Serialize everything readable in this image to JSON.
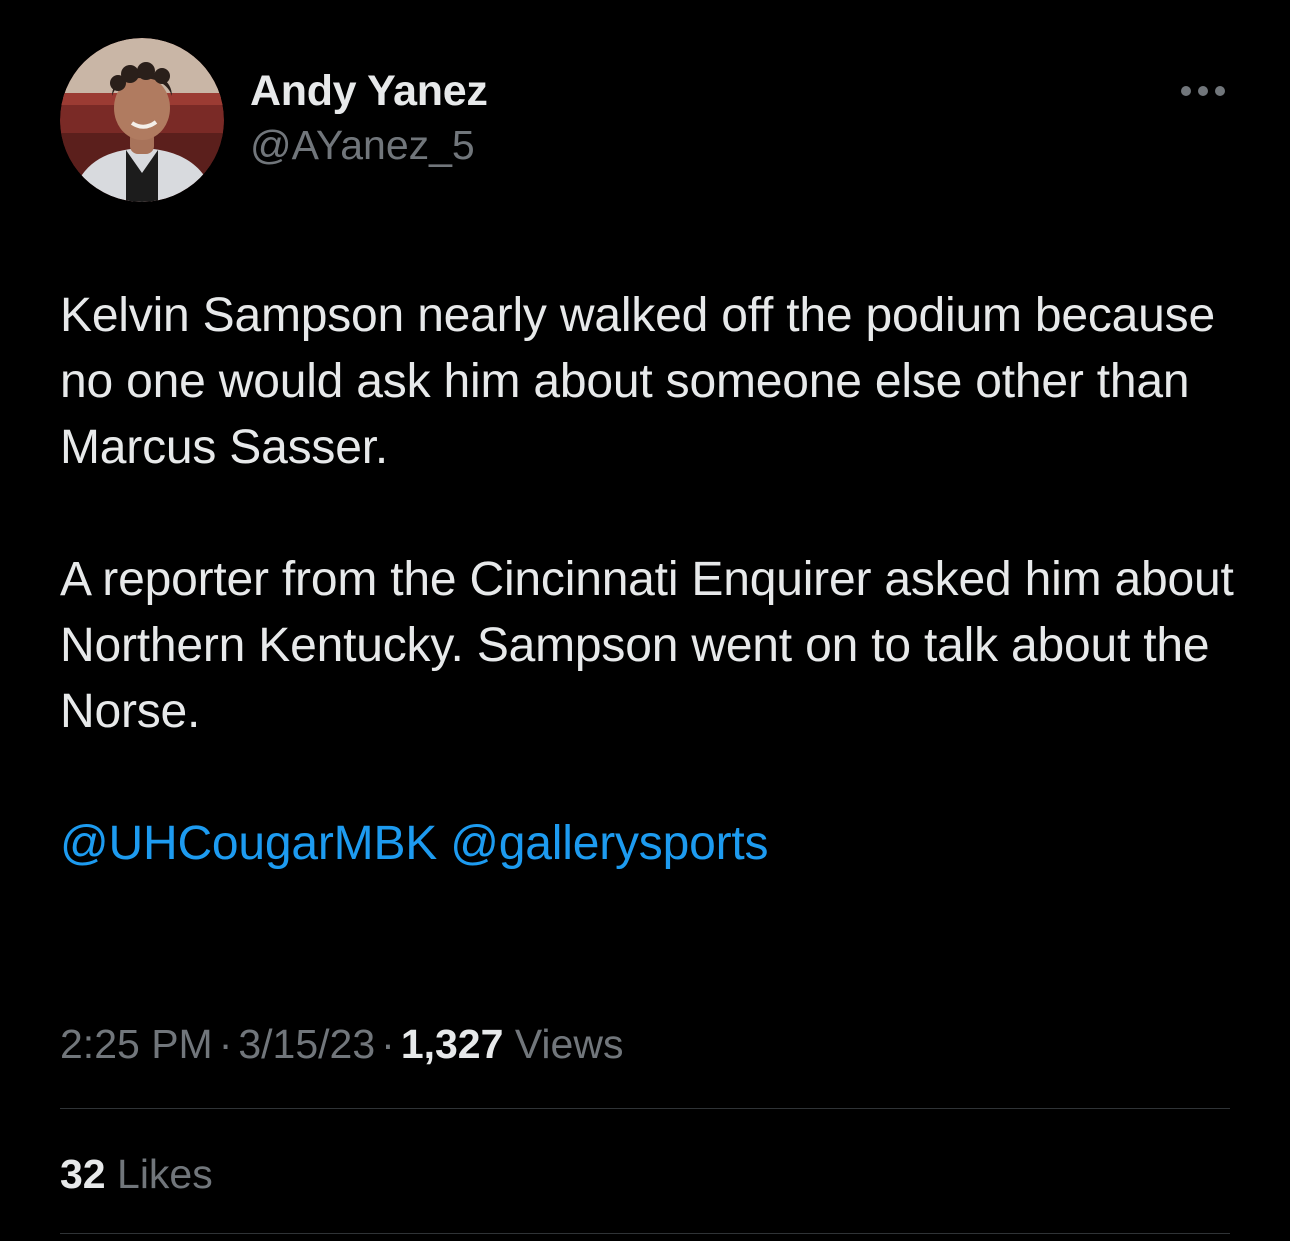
{
  "author": {
    "display_name": "Andy Yanez",
    "handle": "@AYanez_5",
    "avatar_icon": "profile-photo"
  },
  "more_icon": "ellipsis-icon",
  "tweet": {
    "paragraph1": "Kelvin Sampson nearly walked off the podium because no one would ask him about someone else other than Marcus Sasser.",
    "paragraph2": "A reporter from the Cincinnati Enquirer asked him about Northern Kentucky. Sampson went on to talk about the Norse.",
    "mentions": [
      "@UHCougarMBK",
      "@gallerysports"
    ]
  },
  "meta": {
    "time": "2:25 PM",
    "separator": "·",
    "date": "3/15/23",
    "views_count": "1,327",
    "views_label": "Views"
  },
  "engagement": {
    "likes_count": "32",
    "likes_label": "Likes"
  },
  "colors": {
    "background": "#000000",
    "text": "#e7e9ea",
    "secondary": "#71767b",
    "link": "#1d9bf0",
    "divider": "#2f3336"
  }
}
